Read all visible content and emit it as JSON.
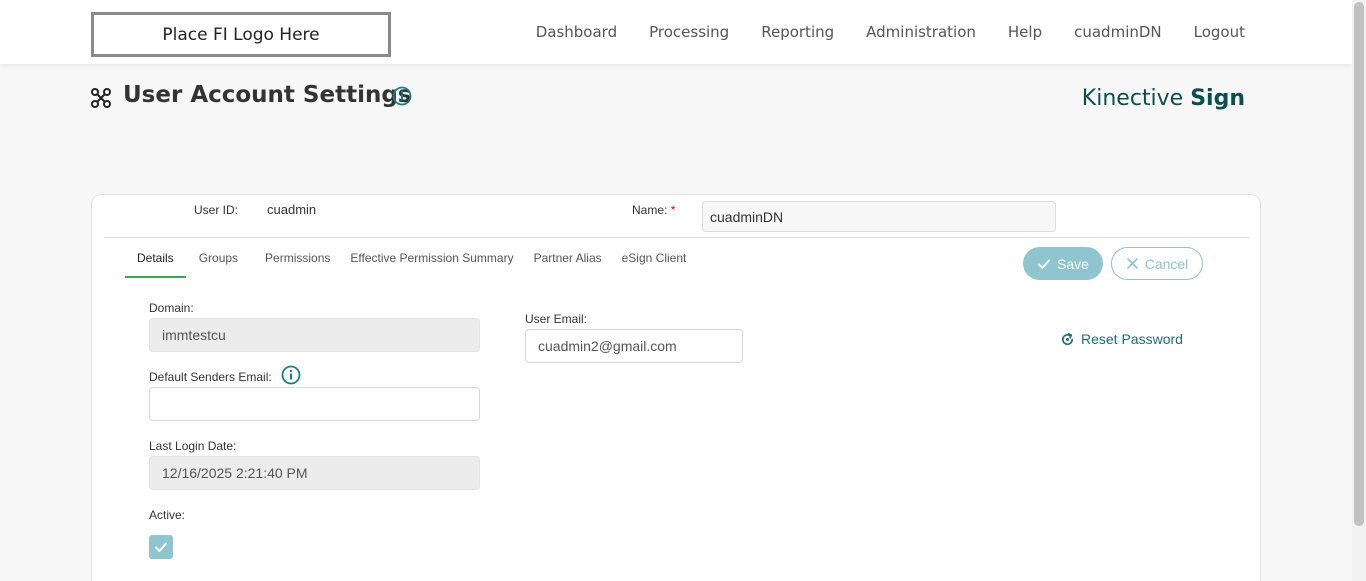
{
  "header": {
    "logo_text": "Place FI Logo Here",
    "nav": [
      "Dashboard",
      "Processing",
      "Reporting",
      "Administration",
      "Help",
      "cuadminDN",
      "Logout"
    ]
  },
  "page": {
    "title": "User Account Settings",
    "brand_light": "Kinective ",
    "brand_bold": "Sign"
  },
  "user": {
    "id_label": "User ID:",
    "id_value": "cuadmin",
    "name_label": "Name:",
    "name_required": "*",
    "name_value": "cuadminDN"
  },
  "tabs": [
    "Details",
    "Groups",
    "Permissions",
    "Effective Permission Summary",
    "Partner Alias",
    "eSign Client"
  ],
  "actions": {
    "save": "Save",
    "cancel": "Cancel",
    "reset_password": "Reset Password"
  },
  "details": {
    "domain_label": "Domain:",
    "domain_value": "immtestcu",
    "default_senders_email_label": "Default Senders Email:",
    "default_senders_email_value": "",
    "last_login_label": "Last Login Date:",
    "last_login_value": "12/16/2025 2:21:40 PM",
    "active_label": "Active:",
    "active_checked": true,
    "user_email_label": "User Email:",
    "user_email_value": "cuadmin2@gmail.com"
  },
  "colors": {
    "accent": "#8ec5ce",
    "brand": "#0b4f50",
    "link": "#1a6e82",
    "active_tab": "#3aa35b",
    "info_icon": "#1a7f86"
  }
}
